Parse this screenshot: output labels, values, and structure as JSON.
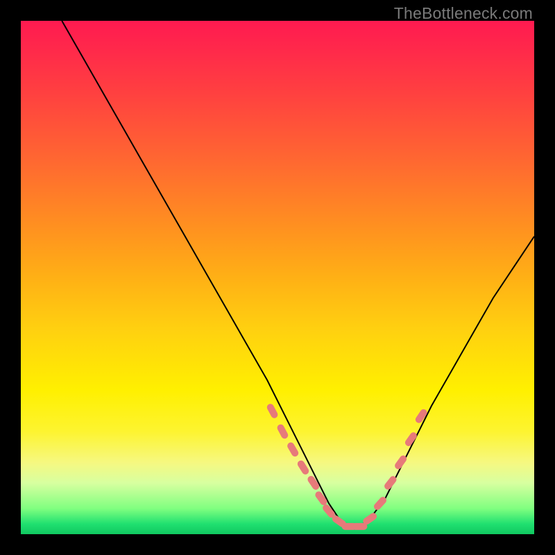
{
  "watermark": "TheBottleneck.com",
  "colors": {
    "frame": "#000000",
    "curve": "#000000",
    "marker": "#e77a7a",
    "marker_stroke": "#e77a7a",
    "gradient_top": "#ff1a50",
    "gradient_bottom": "#10c860"
  },
  "chart_data": {
    "type": "line",
    "title": "",
    "xlabel": "",
    "ylabel": "",
    "xlim": [
      0,
      100
    ],
    "ylim": [
      0,
      100
    ],
    "grid": false,
    "legend_position": "none",
    "series": [
      {
        "name": "bottleneck-curve",
        "x": [
          8,
          12,
          16,
          20,
          24,
          28,
          32,
          36,
          40,
          44,
          48,
          52,
          55,
          58,
          60,
          62,
          64,
          66,
          68,
          71,
          74,
          77,
          80,
          84,
          88,
          92,
          96,
          100
        ],
        "y": [
          100,
          93,
          86,
          79,
          72,
          65,
          58,
          51,
          44,
          37,
          30,
          22,
          16,
          10,
          6,
          3,
          1.5,
          1.5,
          3,
          7,
          13,
          19,
          25,
          32,
          39,
          46,
          52,
          58
        ]
      }
    ],
    "markers": {
      "name": "highlight-dots",
      "x": [
        49,
        51,
        53,
        55,
        57,
        58.5,
        60,
        62,
        64,
        66,
        68,
        70,
        72,
        74,
        76,
        78
      ],
      "y": [
        24,
        20,
        16.5,
        13,
        10,
        7,
        4.5,
        2.5,
        1.5,
        1.5,
        3,
        6,
        10,
        14,
        18.5,
        23
      ],
      "rotation_deg": [
        62,
        62,
        60,
        58,
        56,
        54,
        50,
        35,
        0,
        0,
        -35,
        -48,
        -52,
        -54,
        -55,
        -56
      ]
    }
  }
}
